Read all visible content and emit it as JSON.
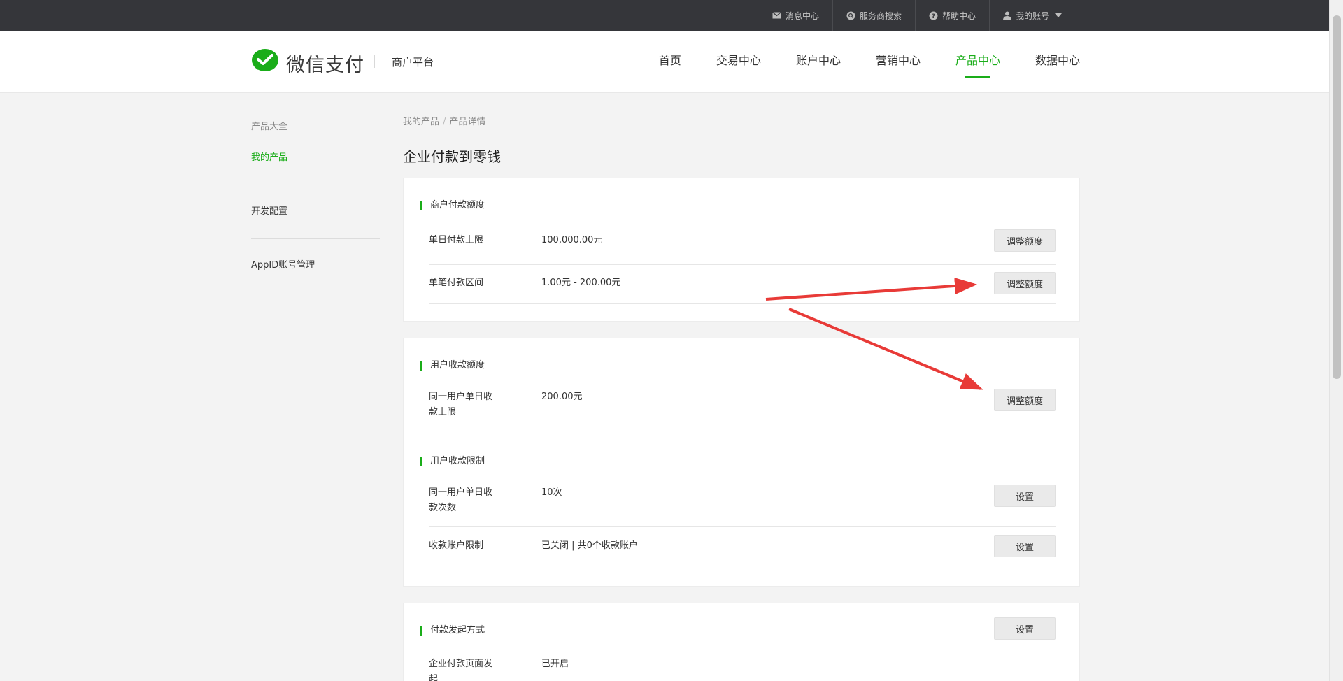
{
  "topbar": {
    "items": [
      {
        "label": "消息中心",
        "icon": "envelope-icon"
      },
      {
        "label": "服务商搜索",
        "icon": "search-icon"
      },
      {
        "label": "帮助中心",
        "icon": "help-icon"
      },
      {
        "label": "我的账号",
        "icon": "user-icon"
      }
    ]
  },
  "header": {
    "logo_text": "微信支付",
    "platform": "商户平台",
    "nav": [
      {
        "label": "首页"
      },
      {
        "label": "交易中心"
      },
      {
        "label": "账户中心"
      },
      {
        "label": "营销中心"
      },
      {
        "label": "产品中心",
        "active": true
      },
      {
        "label": "数据中心"
      }
    ]
  },
  "sidebar": {
    "all_products": "产品大全",
    "my_products": "我的产品",
    "dev_config": "开发配置",
    "appid_manage": "AppID账号管理"
  },
  "breadcrumb": {
    "level1": "我的产品",
    "separator": "/",
    "level2": "产品详情"
  },
  "page_title": "企业付款到零钱",
  "sections": {
    "merchant_quota": {
      "title": "商户付款额度",
      "rows": [
        {
          "label": "单日付款上限",
          "value": "100,000.00元",
          "button": "调整额度"
        },
        {
          "label": "单笔付款区间",
          "value": "1.00元 - 200.00元",
          "button": "调整额度"
        }
      ]
    },
    "user_quota": {
      "title": "用户收款额度",
      "rows": [
        {
          "label": "同一用户单日收款上限",
          "value": "200.00元",
          "button": "调整额度"
        }
      ]
    },
    "user_limit": {
      "title": "用户收款限制",
      "rows": [
        {
          "label": "同一用户单日收款次数",
          "value": "10次",
          "button": "设置"
        },
        {
          "label": "收款账户限制",
          "value": "已关闭 | 共0个收款账户",
          "button": "设置"
        }
      ]
    },
    "payment_method": {
      "title": "付款发起方式",
      "button": "设置",
      "rows": [
        {
          "label": "企业付款页面发起",
          "value": "已开启"
        }
      ]
    }
  },
  "colors": {
    "accent": "#1aad19",
    "topbar_bg": "#35363a",
    "annotation_arrow": "#e83a37"
  }
}
